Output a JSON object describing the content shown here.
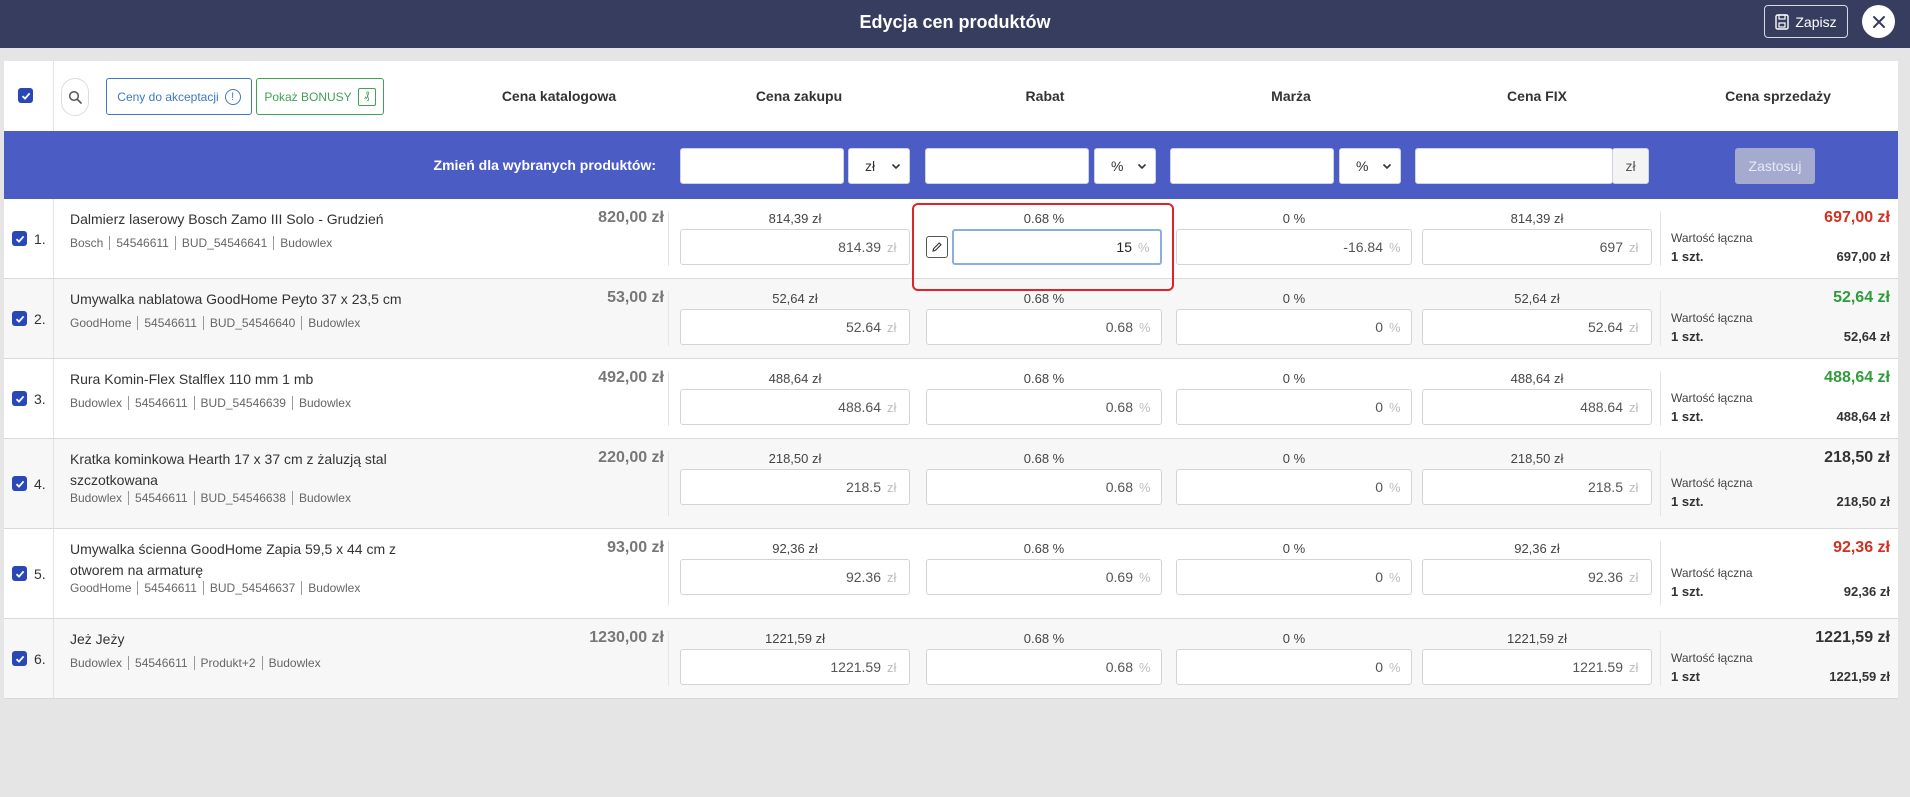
{
  "header": {
    "title": "Edycja cen produktów",
    "save_label": "Zapisz"
  },
  "toolbar": {
    "pending_label": "Ceny do akceptacji",
    "pending_icon": "!",
    "bonus_label": "Pokaż BONUSY",
    "bonus_icon": "₰"
  },
  "columns": {
    "catalog": "Cena katalogowa",
    "purchase": "Cena zakupu",
    "discount": "Rabat",
    "margin": "Marża",
    "fix": "Cena FIX",
    "sale": "Cena sprzedaży"
  },
  "bulk": {
    "label": "Zmień dla wybranych produktów:",
    "purchase_value": "",
    "purchase_unit": "zł",
    "discount_value": "",
    "discount_unit": "%",
    "margin_value": "",
    "margin_unit": "%",
    "fix_value": "",
    "fix_unit": "zł",
    "apply_label": "Zastosuj"
  },
  "units": {
    "pln": "zł",
    "pct": "%"
  },
  "colors": {
    "topbar": "#363d5e",
    "bulk_bar": "#4b5cc4",
    "accent_blue": "#3c78c8",
    "accent_green": "#3fa353",
    "price_red": "#d33021",
    "price_green": "#2f9c3a",
    "highlight_red": "#e0232a"
  },
  "total_label": "Wartość łączna",
  "products": [
    {
      "num": "1.",
      "name": "Dalmierz laserowy Bosch Zamo III Solo - Grudzień",
      "meta": [
        "Bosch",
        "54546611",
        "BUD_54546641",
        "Budowlex"
      ],
      "catalog": "820,00 zł",
      "purchase_caption": "814,39 zł",
      "purchase_value": "814.39",
      "discount_caption": "0.68 %",
      "discount_value": "15",
      "margin_caption": "0 %",
      "margin_value": "-16.84",
      "fix_caption": "814,39 zł",
      "fix_value": "697",
      "sale_price": "697,00 zł",
      "sale_color": "#d33021",
      "qty": "1 szt.",
      "total": "697,00 zł"
    },
    {
      "num": "2.",
      "name": "Umywalka nablatowa GoodHome Peyto 37 x 23,5 cm",
      "meta": [
        "GoodHome",
        "54546611",
        "BUD_54546640",
        "Budowlex"
      ],
      "catalog": "53,00 zł",
      "purchase_caption": "52,64 zł",
      "purchase_value": "52.64",
      "discount_caption": "0.68 %",
      "discount_value": "0.68",
      "margin_caption": "0 %",
      "margin_value": "0",
      "fix_caption": "52,64 zł",
      "fix_value": "52.64",
      "sale_price": "52,64 zł",
      "sale_color": "#2f9c3a",
      "qty": "1 szt.",
      "total": "52,64 zł"
    },
    {
      "num": "3.",
      "name": "Rura Komin-Flex Stalflex 110 mm 1 mb",
      "meta": [
        "Budowlex",
        "54546611",
        "BUD_54546639",
        "Budowlex"
      ],
      "catalog": "492,00 zł",
      "purchase_caption": "488,64 zł",
      "purchase_value": "488.64",
      "discount_caption": "0.68 %",
      "discount_value": "0.68",
      "margin_caption": "0 %",
      "margin_value": "0",
      "fix_caption": "488,64 zł",
      "fix_value": "488.64",
      "sale_price": "488,64 zł",
      "sale_color": "#2f9c3a",
      "qty": "1 szt.",
      "total": "488,64 zł"
    },
    {
      "num": "4.",
      "name": "Kratka kominkowa Hearth 17 x 37 cm z żaluzją stal szczotkowana",
      "meta": [
        "Budowlex",
        "54546611",
        "BUD_54546638",
        "Budowlex"
      ],
      "catalog": "220,00 zł",
      "purchase_caption": "218,50 zł",
      "purchase_value": "218.5",
      "discount_caption": "0.68 %",
      "discount_value": "0.68",
      "margin_caption": "0 %",
      "margin_value": "0",
      "fix_caption": "218,50 zł",
      "fix_value": "218.5",
      "sale_price": "218,50 zł",
      "sale_color": "#333333",
      "qty": "1 szt.",
      "total": "218,50 zł"
    },
    {
      "num": "5.",
      "name": "Umywalka ścienna GoodHome Zapia 59,5 x 44 cm z otworem na armaturę",
      "meta": [
        "GoodHome",
        "54546611",
        "BUD_54546637",
        "Budowlex"
      ],
      "catalog": "93,00 zł",
      "purchase_caption": "92,36 zł",
      "purchase_value": "92.36",
      "discount_caption": "0.68 %",
      "discount_value": "0.69",
      "margin_caption": "0 %",
      "margin_value": "0",
      "fix_caption": "92,36 zł",
      "fix_value": "92.36",
      "sale_price": "92,36 zł",
      "sale_color": "#d33021",
      "qty": "1 szt.",
      "total": "92,36 zł"
    },
    {
      "num": "6.",
      "name": "Jeż Jeży",
      "meta": [
        "Budowlex",
        "54546611",
        "Produkt+2",
        "Budowlex"
      ],
      "catalog": "1230,00 zł",
      "purchase_caption": "1221,59 zł",
      "purchase_value": "1221.59",
      "discount_caption": "0.68 %",
      "discount_value": "0.68",
      "margin_caption": "0 %",
      "margin_value": "0",
      "fix_caption": "1221,59 zł",
      "fix_value": "1221.59",
      "sale_price": "1221,59 zł",
      "sale_color": "#333333",
      "qty": "1 szt",
      "total": "1221,59 zł"
    }
  ]
}
